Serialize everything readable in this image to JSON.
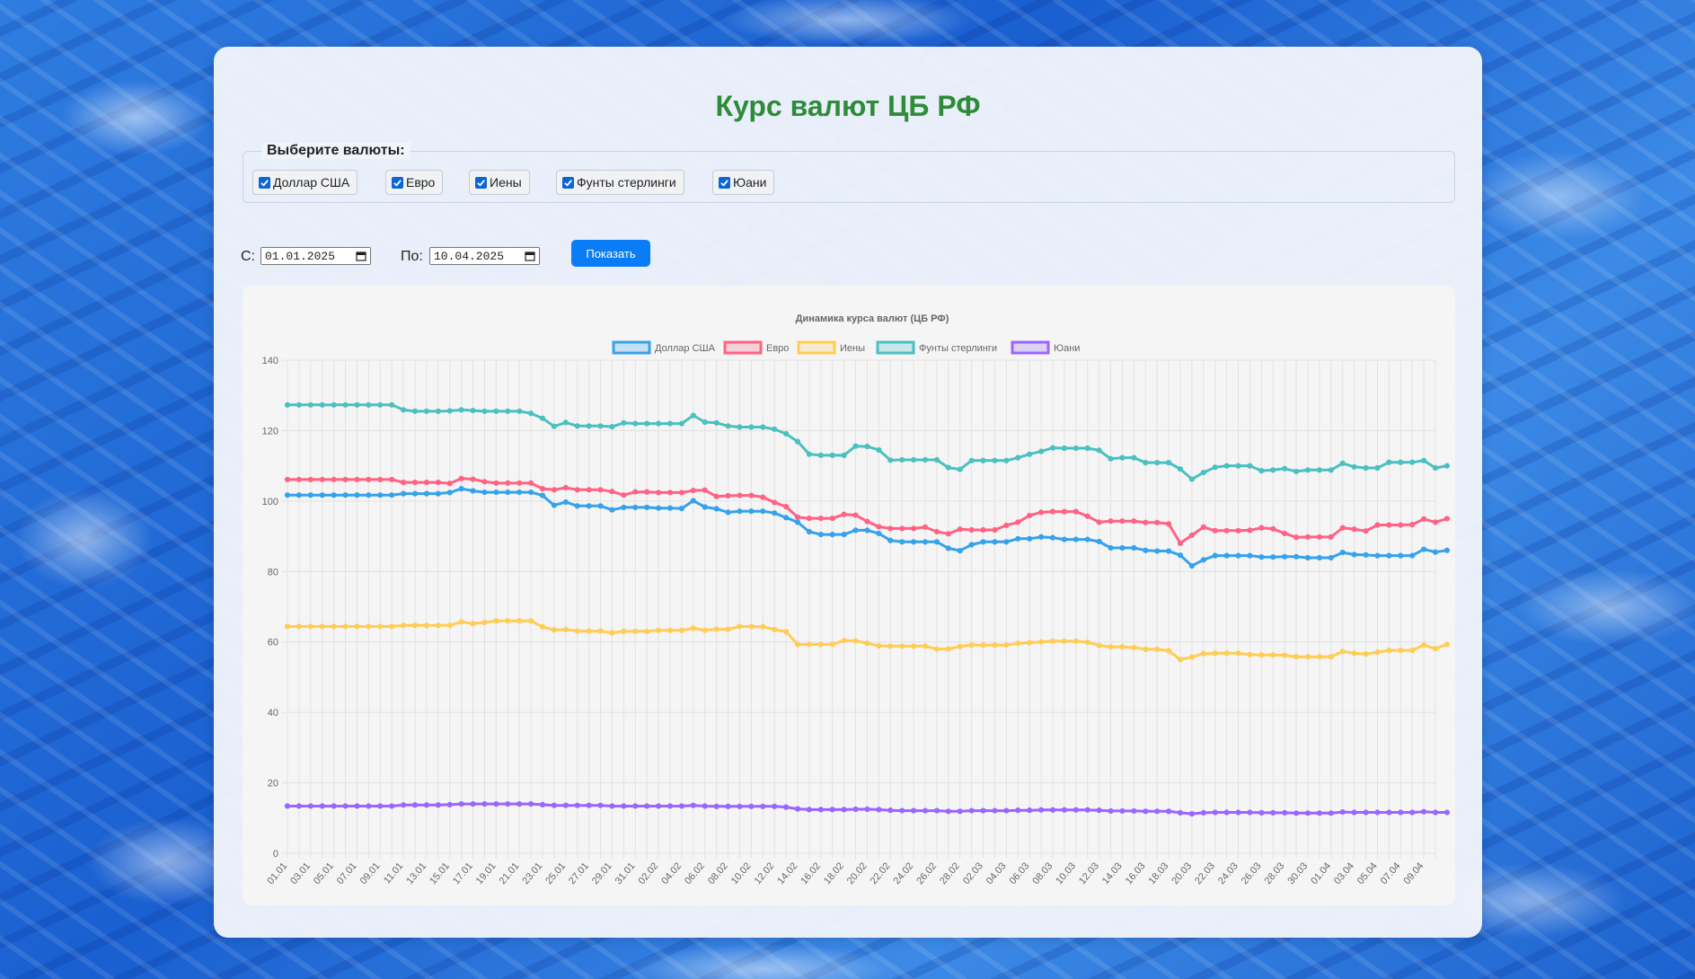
{
  "page": {
    "title": "Курс валют ЦБ РФ"
  },
  "currency_selector": {
    "legend": "Выберите валюты:",
    "options": [
      {
        "label": "Доллар США",
        "checked": true
      },
      {
        "label": "Евро",
        "checked": true
      },
      {
        "label": "Иены",
        "checked": true
      },
      {
        "label": "Фунты стерлинги",
        "checked": true
      },
      {
        "label": "Юани",
        "checked": true
      }
    ]
  },
  "date_range": {
    "from_label": "С:",
    "from_value": "01.01.2025",
    "to_label": "По:",
    "to_value": "10.04.2025",
    "show_button": "Показать"
  },
  "chart_data": {
    "type": "line",
    "title": "Динамика курса валют (ЦБ РФ)",
    "legend_position": "top",
    "grid": true,
    "ylim": [
      0,
      140
    ],
    "yticks": [
      0,
      20,
      40,
      60,
      80,
      100,
      120,
      140
    ],
    "x": [
      "01.01",
      "02.01",
      "03.01",
      "04.01",
      "05.01",
      "06.01",
      "07.01",
      "08.01",
      "09.01",
      "10.01",
      "11.01",
      "12.01",
      "13.01",
      "14.01",
      "15.01",
      "16.01",
      "17.01",
      "18.01",
      "19.01",
      "20.01",
      "21.01",
      "22.01",
      "23.01",
      "24.01",
      "25.01",
      "26.01",
      "27.01",
      "28.01",
      "29.01",
      "30.01",
      "31.01",
      "01.02",
      "02.02",
      "03.02",
      "04.02",
      "05.02",
      "06.02",
      "07.02",
      "08.02",
      "09.02",
      "10.02",
      "11.02",
      "12.02",
      "13.02",
      "14.02",
      "15.02",
      "16.02",
      "17.02",
      "18.02",
      "19.02",
      "20.02",
      "21.02",
      "22.02",
      "23.02",
      "24.02",
      "25.02",
      "26.02",
      "27.02",
      "28.02",
      "01.03",
      "02.03",
      "03.03",
      "04.03",
      "05.03",
      "06.03",
      "07.03",
      "08.03",
      "09.03",
      "10.03",
      "11.03",
      "12.03",
      "13.03",
      "14.03",
      "15.03",
      "16.03",
      "17.03",
      "18.03",
      "19.03",
      "20.03",
      "21.03",
      "22.03",
      "23.03",
      "24.03",
      "25.03",
      "26.03",
      "27.03",
      "28.03",
      "29.03",
      "30.03",
      "31.03",
      "01.04",
      "02.04",
      "03.04",
      "04.04",
      "05.04",
      "06.04",
      "07.04",
      "08.04",
      "09.04",
      "10.04"
    ],
    "series": [
      {
        "name": "Доллар США",
        "color": "#36a2eb",
        "values": [
          101.7,
          101.7,
          101.7,
          101.7,
          101.7,
          101.7,
          101.7,
          101.7,
          101.7,
          101.7,
          102.1,
          102.1,
          102.1,
          102.1,
          102.4,
          103.5,
          102.9,
          102.5,
          102.5,
          102.5,
          102.5,
          102.5,
          101.6,
          98.8,
          99.7,
          98.6,
          98.6,
          98.6,
          97.5,
          98.2,
          98.2,
          98.2,
          98.0,
          98.0,
          97.9,
          100.1,
          98.3,
          97.8,
          96.8,
          97.1,
          97.1,
          97.1,
          96.6,
          95.3,
          94.0,
          91.3,
          90.5,
          90.5,
          90.5,
          91.7,
          91.7,
          90.8,
          88.8,
          88.4,
          88.4,
          88.4,
          88.4,
          86.6,
          85.9,
          87.6,
          88.4,
          88.4,
          88.4,
          89.3,
          89.3,
          89.8,
          89.6,
          89.1,
          89.1,
          89.1,
          88.5,
          86.7,
          86.7,
          86.7,
          86.0,
          85.8,
          85.8,
          84.6,
          81.6,
          83.3,
          84.5,
          84.5,
          84.5,
          84.5,
          84.1,
          84.1,
          84.2,
          84.2,
          83.9,
          83.9,
          83.9,
          85.4,
          84.8,
          84.7,
          84.5,
          84.5,
          84.5,
          84.5,
          86.3,
          85.5,
          86.0
        ]
      },
      {
        "name": "Евро",
        "color": "#ff6384",
        "values": [
          106.1,
          106.1,
          106.1,
          106.1,
          106.1,
          106.1,
          106.1,
          106.1,
          106.1,
          106.1,
          105.3,
          105.3,
          105.3,
          105.3,
          105.0,
          106.4,
          106.2,
          105.5,
          105.1,
          105.1,
          105.1,
          105.1,
          103.5,
          103.2,
          103.8,
          103.2,
          103.2,
          103.2,
          102.7,
          101.7,
          102.6,
          102.6,
          102.4,
          102.4,
          102.4,
          103.0,
          103.1,
          101.3,
          101.5,
          101.6,
          101.6,
          101.1,
          99.6,
          98.4,
          95.4,
          95.1,
          95.1,
          95.1,
          96.2,
          96.0,
          94.2,
          92.7,
          92.2,
          92.2,
          92.2,
          92.6,
          91.3,
          90.7,
          92.0,
          91.8,
          91.8,
          91.8,
          93.1,
          94.0,
          95.9,
          96.8,
          97.0,
          97.0,
          97.0,
          95.7,
          94.0,
          94.3,
          94.3,
          94.3,
          93.9,
          93.9,
          93.5,
          88.0,
          90.3,
          92.6,
          91.6,
          91.6,
          91.6,
          91.7,
          92.4,
          92.1,
          90.8,
          89.7,
          89.8,
          89.8,
          89.8,
          92.4,
          92.0,
          91.5,
          93.2,
          93.2,
          93.2,
          93.3,
          94.9,
          94.0,
          95.0
        ]
      },
      {
        "name": "Иены",
        "color": "#ffcd56",
        "values": [
          64.4,
          64.4,
          64.4,
          64.4,
          64.4,
          64.4,
          64.4,
          64.4,
          64.4,
          64.4,
          64.7,
          64.7,
          64.7,
          64.7,
          64.7,
          65.7,
          65.2,
          65.5,
          66.0,
          66.0,
          66.0,
          66.0,
          64.3,
          63.4,
          63.5,
          63.1,
          63.1,
          63.1,
          62.6,
          63.0,
          63.0,
          63.0,
          63.3,
          63.3,
          63.3,
          63.9,
          63.3,
          63.6,
          63.6,
          64.4,
          64.4,
          64.3,
          63.5,
          62.9,
          59.3,
          59.3,
          59.3,
          59.3,
          60.4,
          60.3,
          59.6,
          58.9,
          58.8,
          58.8,
          58.8,
          58.8,
          58.0,
          58.0,
          58.7,
          59.1,
          59.1,
          59.1,
          59.1,
          59.6,
          59.8,
          60.0,
          60.2,
          60.2,
          60.2,
          59.9,
          59.0,
          58.6,
          58.6,
          58.4,
          57.9,
          57.9,
          57.5,
          55.0,
          55.7,
          56.7,
          56.8,
          56.8,
          56.8,
          56.4,
          56.3,
          56.3,
          56.2,
          55.8,
          55.8,
          55.8,
          55.8,
          57.3,
          56.8,
          56.6,
          57.1,
          57.6,
          57.6,
          57.6,
          59.1,
          58.1,
          59.3
        ]
      },
      {
        "name": "Фунты стерлинги",
        "color": "#4bc0c0",
        "values": [
          127.3,
          127.3,
          127.3,
          127.3,
          127.3,
          127.3,
          127.3,
          127.3,
          127.3,
          127.3,
          125.9,
          125.5,
          125.5,
          125.5,
          125.6,
          125.9,
          125.7,
          125.5,
          125.5,
          125.5,
          125.5,
          124.9,
          123.5,
          121.2,
          122.3,
          121.3,
          121.3,
          121.3,
          121.1,
          122.2,
          122.0,
          122.0,
          122.0,
          122.0,
          122.0,
          124.3,
          122.4,
          122.2,
          121.3,
          121.0,
          121.0,
          121.0,
          120.4,
          119.1,
          116.9,
          113.3,
          113.0,
          113.0,
          113.0,
          115.6,
          115.5,
          114.5,
          111.6,
          111.7,
          111.7,
          111.7,
          111.7,
          109.5,
          109.0,
          111.5,
          111.5,
          111.5,
          111.5,
          112.3,
          113.3,
          114.1,
          115.1,
          115.0,
          115.0,
          115.0,
          114.4,
          112.0,
          112.3,
          112.3,
          110.9,
          110.9,
          110.9,
          109.1,
          106.2,
          108.1,
          109.6,
          110.0,
          110.0,
          110.0,
          108.6,
          108.8,
          109.2,
          108.4,
          108.8,
          108.8,
          108.8,
          110.7,
          109.7,
          109.4,
          109.4,
          111.0,
          111.0,
          111.0,
          111.5,
          109.4,
          110.0
        ]
      },
      {
        "name": "Юани",
        "color": "#9966ff",
        "values": [
          13.4,
          13.4,
          13.4,
          13.4,
          13.4,
          13.4,
          13.4,
          13.4,
          13.4,
          13.4,
          13.7,
          13.7,
          13.7,
          13.7,
          13.8,
          14.0,
          14.0,
          14.0,
          14.0,
          14.0,
          14.0,
          14.0,
          13.8,
          13.6,
          13.6,
          13.6,
          13.6,
          13.6,
          13.4,
          13.4,
          13.4,
          13.4,
          13.4,
          13.4,
          13.4,
          13.6,
          13.4,
          13.3,
          13.3,
          13.3,
          13.3,
          13.3,
          13.3,
          13.1,
          12.6,
          12.4,
          12.4,
          12.4,
          12.4,
          12.5,
          12.5,
          12.4,
          12.2,
          12.1,
          12.1,
          12.1,
          12.1,
          11.9,
          11.9,
          12.1,
          12.1,
          12.1,
          12.1,
          12.2,
          12.2,
          12.3,
          12.3,
          12.3,
          12.3,
          12.3,
          12.2,
          12.0,
          12.0,
          12.0,
          11.9,
          11.9,
          11.9,
          11.5,
          11.2,
          11.5,
          11.6,
          11.6,
          11.6,
          11.6,
          11.5,
          11.5,
          11.5,
          11.4,
          11.4,
          11.4,
          11.4,
          11.7,
          11.6,
          11.6,
          11.6,
          11.6,
          11.6,
          11.6,
          11.8,
          11.6,
          11.6
        ]
      }
    ]
  }
}
